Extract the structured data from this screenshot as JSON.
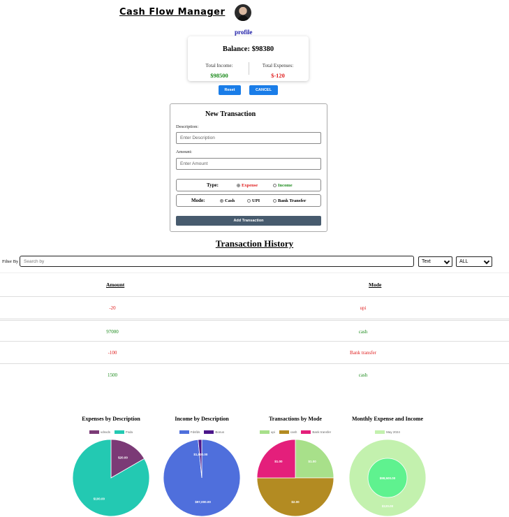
{
  "header": {
    "title": "Cash Flow Manager",
    "profile_label": "profile"
  },
  "balance": {
    "balance_text": "Balance: $98380",
    "income_label": "Total Income:",
    "income_value": "$98500",
    "expense_label": "Total Expenses:",
    "expense_value": "$-120"
  },
  "actions": {
    "reset_label": "Reset",
    "cancel_label": "CANCEL"
  },
  "form": {
    "title": "New Transaction",
    "description_label": "Description:",
    "description_placeholder": "Enter Description",
    "amount_label": "Amount:",
    "amount_placeholder": "Enter Amount",
    "type_label": "Type:",
    "type_options": [
      "Expense",
      "Income"
    ],
    "type_selected": "Expense",
    "mode_label": "Mode:",
    "mode_options": [
      "Cash",
      "UPI",
      "Bank Transfer"
    ],
    "mode_selected": "Cash",
    "submit_label": "Add Transaction"
  },
  "history": {
    "title": "Transaction History",
    "filter_label": "Filter By",
    "search_placeholder": "Search by",
    "type_filter_value": "Text",
    "mode_filter_value": "ALL",
    "columns": [
      "Amount",
      "Mode"
    ],
    "rows": [
      {
        "amount": "-20",
        "mode": "upi",
        "kind": "expense"
      },
      {
        "amount": "97000",
        "mode": "cash",
        "kind": "income"
      },
      {
        "amount": "-100",
        "mode": "Bank transfer",
        "kind": "expense"
      },
      {
        "amount": "1500",
        "mode": "cash",
        "kind": "income"
      }
    ]
  },
  "colors": {
    "income": "#1b8a1b",
    "expense": "#e02020",
    "accent": "#1a7de8",
    "submit": "#475b6e"
  },
  "chart_data": [
    {
      "type": "pie",
      "title": "Expenses by Description",
      "categories": [
        "vdsvds",
        "Fsda"
      ],
      "values": [
        20,
        100
      ],
      "value_labels": [
        "$20.00",
        "$100.00"
      ],
      "colors": [
        "#7b3a76",
        "#23c9b2"
      ]
    },
    {
      "type": "pie",
      "title": "Income by Description",
      "categories": [
        "Fdsfds",
        "Bonus"
      ],
      "values": [
        97000,
        1500
      ],
      "value_labels": [
        "$97,000.00",
        "$1,500.00"
      ],
      "colors": [
        "#4f6fdc",
        "#4b168a"
      ]
    },
    {
      "type": "pie",
      "title": "Transactions by Mode",
      "categories": [
        "upi",
        "cash",
        "Bank transfer"
      ],
      "values": [
        1,
        2,
        1
      ],
      "value_labels": [
        "$1.00",
        "$2.00",
        "$1.00"
      ],
      "colors": [
        "#a8e08a",
        "#b38b22",
        "#e41f7b"
      ]
    },
    {
      "type": "doughnut",
      "title": "Monthly Expense and Income",
      "categories": [
        "May 2024"
      ],
      "series": [
        {
          "values": [
            98500
          ],
          "value_labels": [
            "$98,500.00"
          ]
        },
        {
          "values": [
            120
          ],
          "value_labels": [
            "$120.00"
          ]
        }
      ],
      "colors": [
        "#c3f1ae",
        "#5ff28f"
      ]
    }
  ]
}
